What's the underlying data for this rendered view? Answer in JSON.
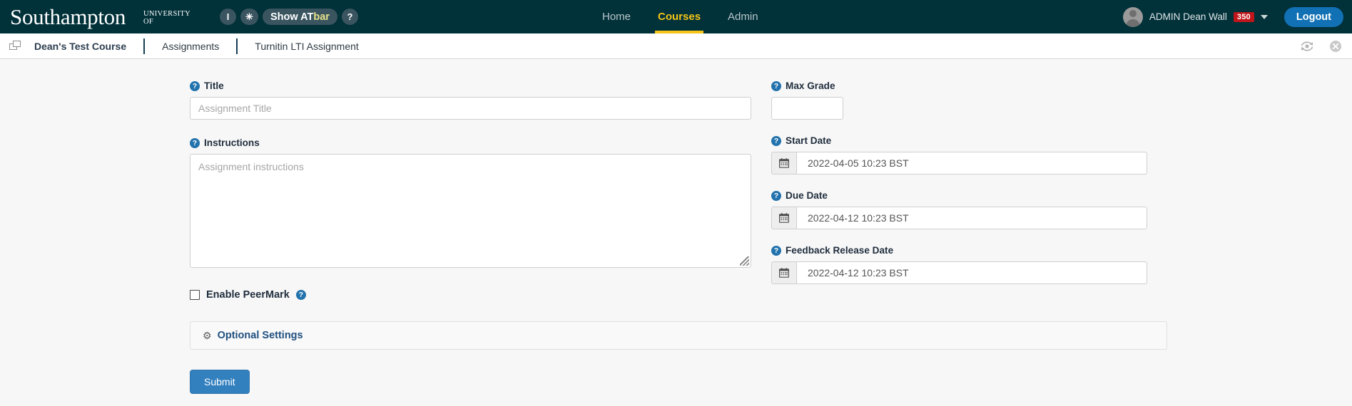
{
  "topbar": {
    "logo": {
      "line1": "UNIVERSITY OF",
      "line2": "Southampton"
    },
    "atbar": {
      "text_size_icon": "I",
      "contrast_icon": "✳",
      "show_label_main": "Show AT",
      "show_label_accent": "bar",
      "help_label": "?"
    },
    "nav": [
      {
        "label": "Home",
        "active": false
      },
      {
        "label": "Courses",
        "active": true
      },
      {
        "label": "Admin",
        "active": false
      }
    ],
    "user": {
      "name": "ADMIN Dean Wall",
      "badge": "350",
      "logout_label": "Logout"
    },
    "colors": {
      "bar_bg": "#013139",
      "accent": "#f5c518",
      "badge": "#c0151a",
      "logout": "#1271b5"
    }
  },
  "breadcrumb": {
    "window_icon": "windows-icon",
    "items": [
      {
        "label": "Dean's Test Course"
      },
      {
        "label": "Assignments"
      },
      {
        "label": "Turnitin LTI Assignment"
      }
    ],
    "actions": [
      {
        "name": "refresh-icon"
      },
      {
        "name": "close-icon"
      }
    ]
  },
  "form": {
    "title": {
      "label": "Title",
      "help": "?",
      "value": "",
      "placeholder": "Assignment Title"
    },
    "instructions": {
      "label": "Instructions",
      "help": "?",
      "value": "",
      "placeholder": "Assignment instructions"
    },
    "max_grade": {
      "label": "Max Grade",
      "help": "?",
      "value": "",
      "placeholder": ""
    },
    "start_date": {
      "label": "Start Date",
      "help": "?",
      "value": "2022-04-05 10:23 BST",
      "icon": "calendar-icon"
    },
    "due_date": {
      "label": "Due Date",
      "help": "?",
      "value": "2022-04-12 10:23 BST",
      "icon": "calendar-icon"
    },
    "feedback_release_date": {
      "label": "Feedback Release Date",
      "help": "?",
      "value": "2022-04-12 10:23 BST",
      "icon": "calendar-icon"
    },
    "peermark": {
      "label": "Enable PeerMark",
      "help": "?",
      "checked": false
    },
    "optional_settings": {
      "label": "Optional Settings",
      "icon": "gear-icon",
      "glyph": "⚙"
    },
    "submit": {
      "label": "Submit"
    }
  }
}
